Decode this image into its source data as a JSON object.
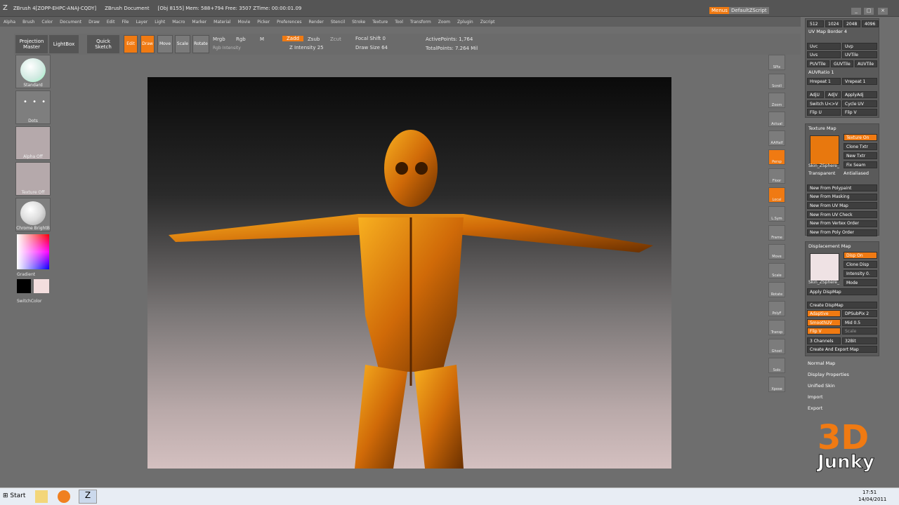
{
  "title": {
    "left": "ZBrush 4[ZOPP-EHPC-ANAJ-CQDY]",
    "doc": "ZBrush Document",
    "info": "[Obj 8155] Mem: 588+794 Free: 3507 ZTime: 00:00:01.09",
    "menus": "Menus",
    "script": "DefaultZScript"
  },
  "menubar": [
    "Alpha",
    "Brush",
    "Color",
    "Document",
    "Draw",
    "Edit",
    "File",
    "Layer",
    "Light",
    "Macro",
    "Marker",
    "Material",
    "Movie",
    "Picker",
    "Preferences",
    "Render",
    "Stencil",
    "Stroke",
    "Texture",
    "Tool",
    "Transform",
    "Zoom",
    "Zplugin",
    "Zscript"
  ],
  "toolbar": {
    "projection_master": "Projection Master",
    "lightbox": "LightBox",
    "quick_sketch": "Quick Sketch",
    "edit": "Edit",
    "draw": "Draw",
    "move": "Move",
    "scale": "Scale",
    "rotate": "Rotate",
    "mrgb": "Mrgb",
    "rgb": "Rgb",
    "m": "M",
    "rgb_intensity": "Rgb Intensity",
    "zadd": "Zadd",
    "zsub": "Zsub",
    "zcut": "Zcut",
    "z_intensity": "Z Intensity 25",
    "focal_shift": "Focal Shift 0",
    "draw_size": "Draw Size 64",
    "active_points": "ActivePoints: 1,764",
    "total_points": "TotalPoints: 7.264 Mil"
  },
  "lefttray": {
    "standard": "Standard",
    "dots": "Dots",
    "alpha": "Alpha Off",
    "texture": "Texture Off",
    "material": "Chrome BrightB",
    "gradient": "Gradient",
    "switch_color": "SwitchColor"
  },
  "righttools": [
    "SPix",
    "Scroll",
    "Zoom",
    "Actual",
    "AAHalf",
    "Persp",
    "Floor",
    "Local",
    "L.Sym",
    "Frame",
    "Move",
    "Scale",
    "Rotate",
    "PolyF",
    "Transp",
    "Ghost",
    "Solo",
    "Xpose"
  ],
  "uvpanel": {
    "sizes": [
      "512",
      "1024",
      "2048",
      "4096"
    ],
    "border": "UV Map Border 4",
    "uvc": "Uvc",
    "uvp": "Uvp",
    "uvs": "Uvs",
    "uvtile": "UVTile",
    "puvtile": "PUVTile",
    "guvtile": "GUVTile",
    "auvtile": "AUVTile",
    "auvratio": "AUVRatio 1",
    "hrepeat": "Hrepeat 1",
    "vrepeat": "Vrepeat 1",
    "adju": "AdjU",
    "adjv": "AdjV",
    "applyadj": "ApplyAdj",
    "switch_uv": "Switch U<>V",
    "cycle_uv": "Cycle UV",
    "flip_u": "Flip U",
    "flip_v": "Flip V"
  },
  "texmap": {
    "header": "Texture Map",
    "thumb_label": "Skin_ZSphere_",
    "texture_on": "Texture On",
    "clone": "Clone Txtr",
    "new": "New Txtr",
    "fix": "Fix Seam",
    "transparent": "Transparent",
    "antialiased": "Antialiased",
    "buttons": [
      "New From Polypaint",
      "New From Masking",
      "New From UV Map",
      "New From UV Check",
      "New From Vertex Order",
      "New From Poly Order"
    ]
  },
  "dispmap": {
    "header": "Displacement Map",
    "thumb_label": "Skin_ZSphere_",
    "disp_on": "Disp On",
    "clone": "Clone Disp",
    "intensity": "Intensity 0.",
    "mode": "Mode",
    "apply": "Apply DispMap",
    "create": "Create DispMap",
    "adaptive": "Adaptive",
    "dpsubpix": "DPSubPix 2",
    "smoothuv": "SmoothUV",
    "mid": "Mid 0.5",
    "flipv": "Flip V",
    "scale": "Scale",
    "channels": "3 Channels",
    "bit": "32Bit",
    "create_export": "Create And Export Map"
  },
  "subpanels": [
    "Normal Map",
    "Display Properties",
    "Unified Skin",
    "Import",
    "Export"
  ],
  "logo": {
    "top": "3D",
    "bottom": "Junky"
  },
  "taskbar": {
    "start": "Start",
    "time": "17:51",
    "date": "14/04/2011"
  },
  "colors": {
    "accent": "#f07a12",
    "figure": "#e08a10"
  }
}
